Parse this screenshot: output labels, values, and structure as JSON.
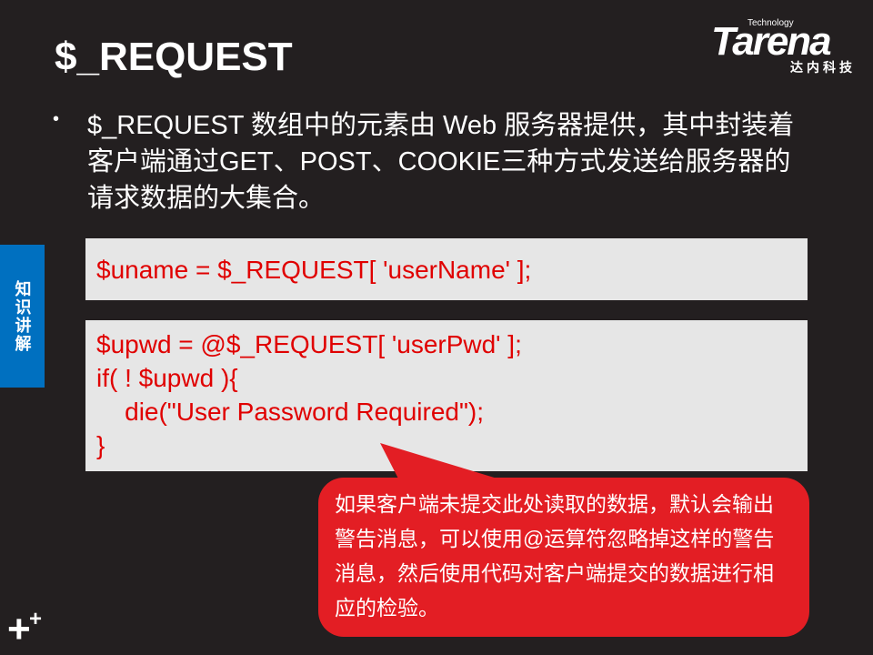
{
  "slide": {
    "title": "$_REQUEST",
    "logo": {
      "name": "Tarena",
      "tagline": "Technology",
      "cn": "达内科技"
    },
    "side_label": "知识讲解",
    "bullet": "•",
    "paragraph": "$_REQUEST 数组中的元素由 Web 服务器提供，其中封装着客户端通过GET、POST、COOKIE三种方式发送给服务器的请求数据的大集合。",
    "code1": "$uname = $_REQUEST[ 'userName' ];",
    "code2": "$upwd = @$_REQUEST[ 'userPwd' ];\nif( ! $upwd ){\n    die(\"User Password Required\");\n}",
    "callout": "如果客户端未提交此处读取的数据，默认会输出警告消息，可以使用@运算符忽略掉这样的警告消息，然后使用代码对客户端提交的数据进行相应的检验。",
    "colors": {
      "background": "#231f20",
      "accent": "#0070c0",
      "code": "#e00000",
      "callout": "#e31e24"
    }
  }
}
